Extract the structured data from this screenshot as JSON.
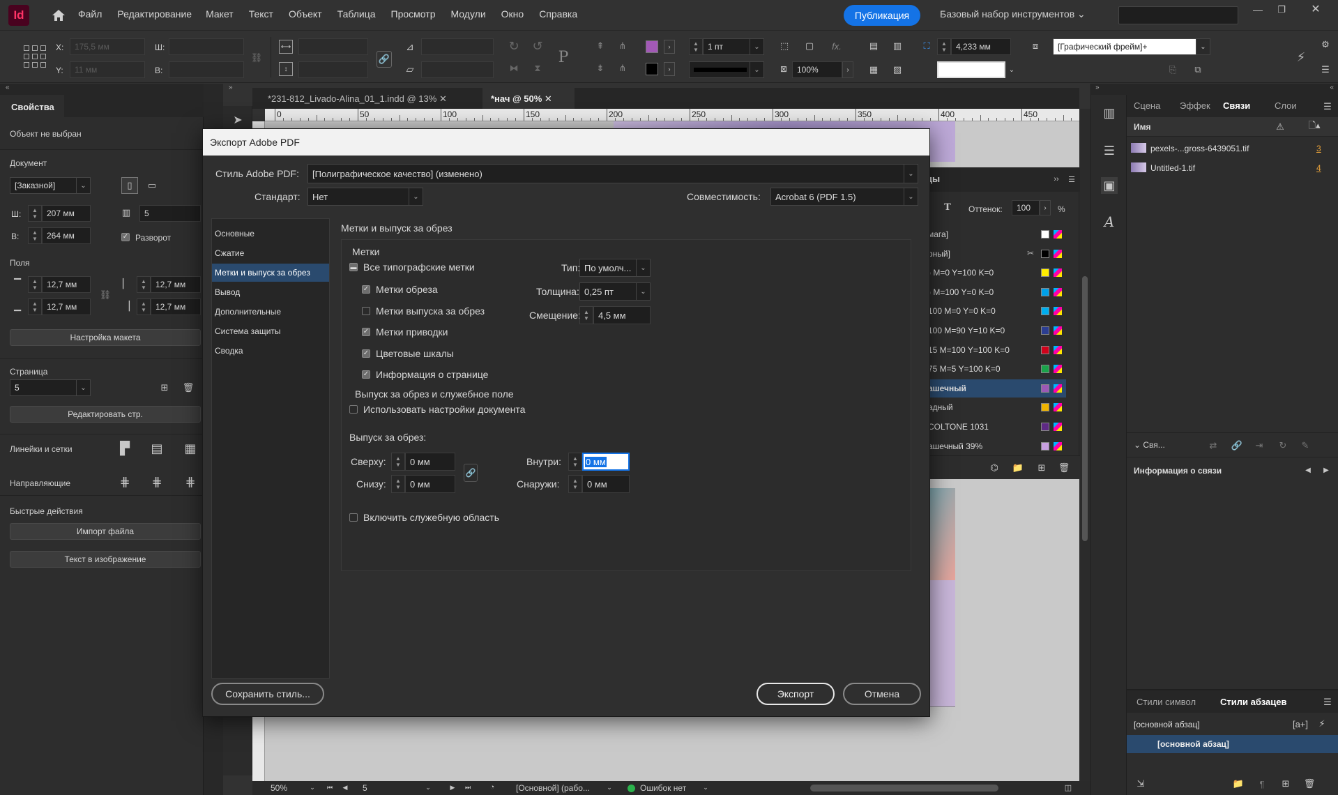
{
  "app": {
    "logo": "Id"
  },
  "menu": [
    "Файл",
    "Редактирование",
    "Макет",
    "Текст",
    "Объект",
    "Таблица",
    "Просмотр",
    "Модули",
    "Окно",
    "Справка"
  ],
  "publish": "Публикация",
  "workspace": "Базовый набор инструментов",
  "control": {
    "x_label": "X:",
    "y_label": "Y:",
    "w_label": "Ш:",
    "h_label": "В:",
    "x": "175,5 мм",
    "y": "11 мм",
    "stroke": "1 пт",
    "ref": "4,233 мм",
    "zoom": "100%",
    "frame": "[Графический фрейм]+"
  },
  "tabs": [
    {
      "label": "*231-812_Livado-Alina_01_1.indd @ 13%"
    },
    {
      "label": "*нач @ 50%"
    }
  ],
  "ruler": [
    "0",
    "50",
    "100",
    "150",
    "200",
    "250",
    "300",
    "350",
    "400",
    "450"
  ],
  "props": {
    "title": "Свойства",
    "no_object": "Объект не выбран",
    "doc": "Документ",
    "preset": "[Заказной]",
    "w_label": "Ш:",
    "h_label": "В:",
    "w": "207 мм",
    "h": "264 мм",
    "pages": "5",
    "spread": "Разворот",
    "margins": "Поля",
    "m_top": "12,7 мм",
    "m_bottom": "12,7 мм",
    "m_left": "12,7 мм",
    "m_right": "12,7 мм",
    "layout_btn": "Настройка макета",
    "page": "Страница",
    "page_val": "5",
    "edit_page": "Редактировать стр.",
    "rulers": "Линейки и сетки",
    "guides": "Направляющие",
    "quick": "Быстрые действия",
    "import": "Импорт файла",
    "text_in_image": "Текст в изображение"
  },
  "swatches": {
    "title": "цы",
    "tint_label": "Оттенок:",
    "tint": "100",
    "pct": "%",
    "items": [
      "мага]",
      "рный]",
      ") M=0 Y=100 K=0",
      ") M=100 Y=0 K=0",
      "100 M=0 Y=0 K=0",
      "100 M=90 Y=10 K=0",
      "15 M=100 Y=100 K=0",
      "75 M=5 Y=100 K=0",
      "ашечный",
      "адный",
      "COLTONE 1031",
      "ашечный 39%"
    ]
  },
  "links": {
    "tabs": [
      "Сцена",
      "Эффек",
      "Связи",
      "Слои"
    ],
    "name_col": "Имя",
    "items": [
      {
        "name": "pexels-...gross-6439051.tif",
        "page": "3"
      },
      {
        "name": "Untitled-1.tif",
        "page": "4"
      }
    ],
    "collapse": "Свя...",
    "info": "Информация о связи"
  },
  "para": {
    "tabs": [
      "Стили символ",
      "Стили абзацев"
    ],
    "current": "[основной абзац]",
    "selected": "[основной абзац]"
  },
  "status": {
    "zoom": "50%",
    "page": "5",
    "style": "[Основной] (рабо...",
    "errors": "Ошибок нет"
  },
  "dialog": {
    "title": "Экспорт Adobe PDF",
    "style_label": "Стиль Adobe PDF:",
    "style_value": "[Полиграфическое качество] (изменено)",
    "standard_label": "Стандарт:",
    "standard_value": "Нет",
    "compat_label": "Совместимость:",
    "compat_value": "Acrobat 6 (PDF 1.5)",
    "nav": [
      "Основные",
      "Сжатие",
      "Метки и выпуск за обрез",
      "Вывод",
      "Дополнительные",
      "Система защиты",
      "Сводка"
    ],
    "section": "Метки и выпуск за обрез",
    "marks_group": "Метки",
    "all_marks": "Все типографские метки",
    "marks": [
      "Метки обреза",
      "Метки выпуска за обрез",
      "Метки приводки",
      "Цветовые шкалы",
      "Информация о странице"
    ],
    "type_label": "Тип:",
    "type_value": "По умолч...",
    "weight_label": "Толщина:",
    "weight_value": "0,25 пт",
    "offset_label": "Смещение:",
    "offset_value": "4,5 мм",
    "bleed_group": "Выпуск за обрез и служебное поле",
    "use_doc": "Использовать настройки документа",
    "bleed_label": "Выпуск за обрез:",
    "top_label": "Сверху:",
    "top_value": "0 мм",
    "bottom_label": "Снизу:",
    "bottom_value": "0 мм",
    "inside_label": "Внутри:",
    "inside_value": "0 мм",
    "outside_label": "Снаружи:",
    "outside_value": "0 мм",
    "slug": "Включить служебную область",
    "save_style": "Сохранить стиль...",
    "export": "Экспорт",
    "cancel": "Отмена"
  }
}
